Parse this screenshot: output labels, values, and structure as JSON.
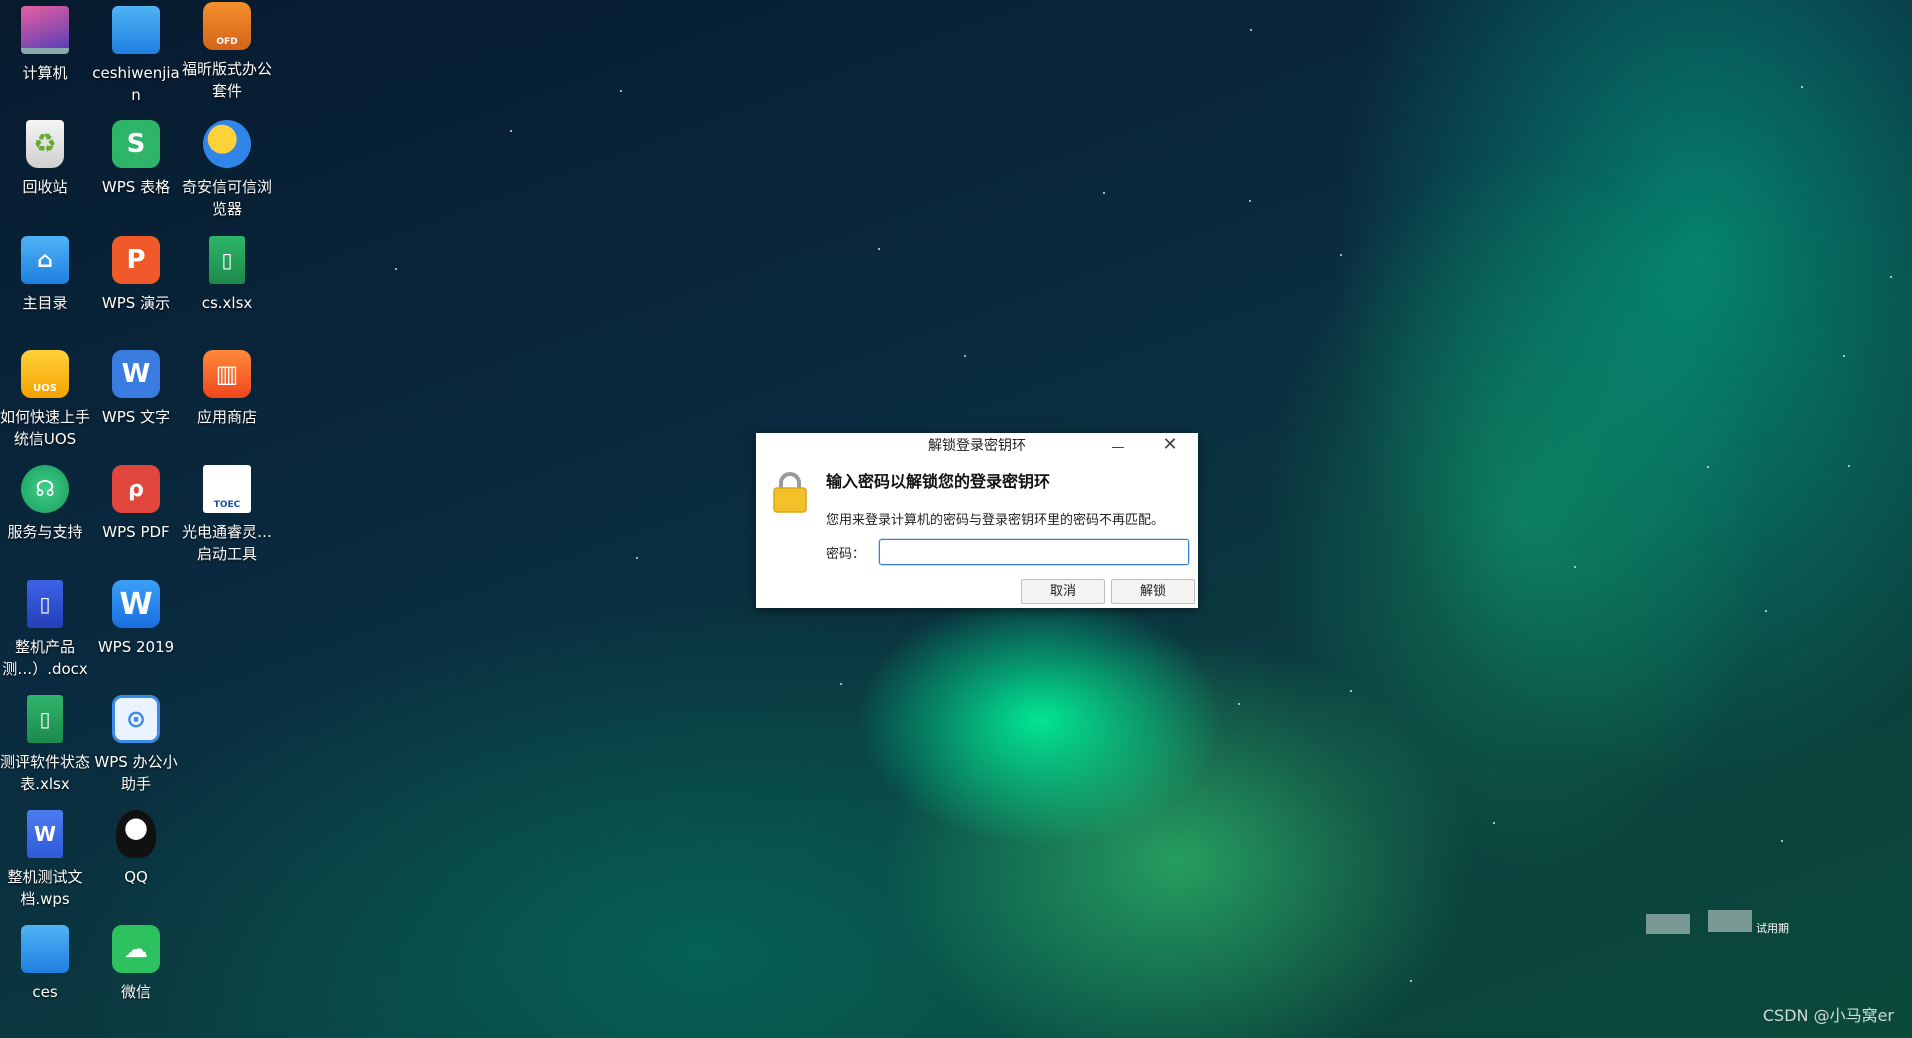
{
  "desktop": {
    "icons": [
      {
        "label": "计算机",
        "icon": "computer-icon"
      },
      {
        "label": "ceshiwenjian",
        "icon": "folder-icon"
      },
      {
        "label": "福昕版式办公套件",
        "icon": "ofd-icon",
        "badge": "OFD"
      },
      {
        "label": "回收站",
        "icon": "trash-icon"
      },
      {
        "label": "WPS 表格",
        "icon": "wps-spreadsheet-icon",
        "glyph": "S"
      },
      {
        "label": "奇安信可信浏览器",
        "icon": "browser-icon"
      },
      {
        "label": "主目录",
        "icon": "home-folder-icon"
      },
      {
        "label": "WPS 演示",
        "icon": "wps-presentation-icon",
        "glyph": "P"
      },
      {
        "label": "cs.xlsx",
        "icon": "xlsx-file-icon"
      },
      {
        "label": "如何快速上手统信UOS",
        "icon": "uos-guide-icon",
        "badge": "UOS"
      },
      {
        "label": "WPS 文字",
        "icon": "wps-writer-icon",
        "glyph": "W"
      },
      {
        "label": "应用商店",
        "icon": "app-store-icon"
      },
      {
        "label": "服务与支持",
        "icon": "support-icon"
      },
      {
        "label": "WPS PDF",
        "icon": "wps-pdf-icon"
      },
      {
        "label": "光电通睿灵…启动工具",
        "icon": "toec-icon",
        "badge": "TOEC"
      },
      {
        "label": "整机产品测…）.docx",
        "icon": "docx-file-icon"
      },
      {
        "label": "WPS 2019",
        "icon": "wps-2019-icon",
        "glyph": "W"
      },
      {
        "label": "测评软件状态表.xlsx",
        "icon": "xlsx-file-icon-2"
      },
      {
        "label": "WPS 办公小助手",
        "icon": "wps-assistant-icon"
      },
      {
        "label": "整机测试文档.wps",
        "icon": "wps-file-icon",
        "glyph": "W"
      },
      {
        "label": "QQ",
        "icon": "qq-icon"
      },
      {
        "label": "ces",
        "icon": "folder-icon-2"
      },
      {
        "label": "微信",
        "icon": "wechat-icon"
      }
    ]
  },
  "dialog": {
    "title": "解锁登录密钥环",
    "heading": "输入密码以解锁您的登录密钥环",
    "description": "您用来登录计算机的密码与登录密钥环里的密码不再匹配。",
    "password_label": "密码：",
    "password_value": "",
    "cancel_label": "取消",
    "unlock_label": "解锁"
  },
  "watermark": {
    "trial_text": "试用期",
    "csdn_text": "CSDN @小马窝er"
  },
  "colors": {
    "accent": "#2f7fd6",
    "wps_green": "#2fb56a",
    "wps_orange": "#f05a2a",
    "wps_blue": "#3a7be0",
    "wps_red": "#e0463c"
  }
}
